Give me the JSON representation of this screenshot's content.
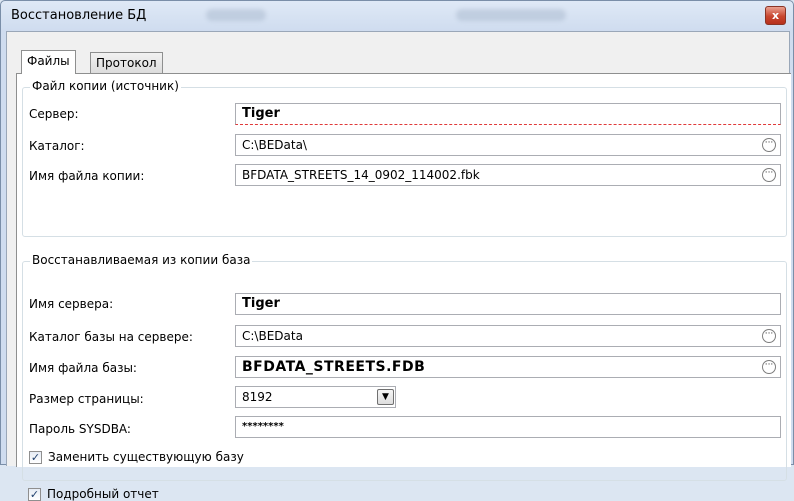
{
  "window": {
    "title": "Восстановление БД",
    "close_glyph": "x"
  },
  "tabs": [
    {
      "label": "Файлы"
    },
    {
      "label": "Протокол"
    }
  ],
  "source_group": {
    "title": "Файл копии (источник)",
    "server_label": "Сервер:",
    "server_value": "Tiger",
    "catalog_label": "Каталог:",
    "catalog_value": "C:\\BEData\\",
    "file_label": "Имя файла копии:",
    "file_value": "BFDATA_STREETS_14_0902_114002.fbk"
  },
  "target_group": {
    "title": "Восстанавливаемая из копии база",
    "server_label": "Имя сервера:",
    "server_value": "Tiger",
    "catalog_label": "Каталог базы на сервере:",
    "catalog_value": "C:\\BEData",
    "file_label": "Имя файла базы:",
    "file_value": "BFDATA_STREETS.FDB",
    "page_size_label": "Размер страницы:",
    "page_size_value": "8192",
    "password_label": "Пароль SYSDBA:",
    "password_value": "********"
  },
  "options": {
    "replace_label": "Заменить существующую базу",
    "replace_checked": true,
    "verbose_label": "Подробный отчет",
    "verbose_checked": true
  },
  "glyphs": {
    "ellipsis": "···",
    "dropdown": "▼",
    "check": "✓"
  },
  "colors": {
    "error_underline": "#e03a3a",
    "close_button": "#c8462f"
  }
}
